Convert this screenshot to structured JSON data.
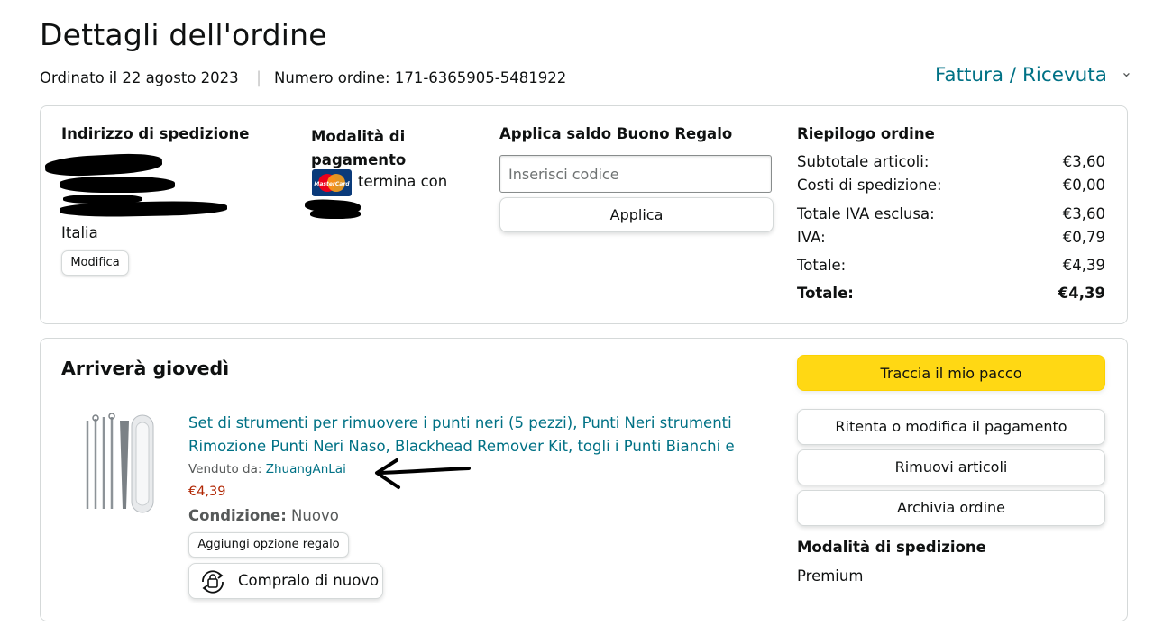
{
  "page": {
    "title": "Dettagli dell'ordine",
    "ordered_on": "Ordinato il 22 agosto 2023",
    "order_number": "Numero ordine: 171-6365905-5481922",
    "invoice_link": "Fattura / Ricevuta",
    "invoice_chevron": "⌄"
  },
  "shipping_address": {
    "heading": "Indirizzo di spedizione",
    "country": "Italia",
    "edit_label": "Modifica"
  },
  "payment": {
    "heading": "Modalità di pagamento",
    "card_brand": "MasterCard",
    "ending_text": "termina con"
  },
  "gift_card": {
    "heading": "Applica saldo Buono Regalo",
    "placeholder": "Inserisci codice",
    "value": "",
    "apply_label": "Applica"
  },
  "summary": {
    "heading": "Riepilogo ordine",
    "rows": [
      {
        "label": "Subtotale articoli:",
        "value": "€3,60"
      },
      {
        "label": "Costi di spedizione:",
        "value": "€0,00"
      },
      {
        "label": "Totale IVA esclusa:",
        "value": "€3,60"
      },
      {
        "label": "IVA:",
        "value": "€0,79"
      },
      {
        "label": "Totale:",
        "value": "€4,39"
      },
      {
        "label": "Totale:",
        "value": "€4,39"
      }
    ]
  },
  "shipment": {
    "arrival": "Arriverà giovedì",
    "product_title_line1": "Set di strumenti per rimuovere i punti neri (5 pezzi), Punti Neri strumenti",
    "product_title_line2": "Rimozione Punti Neri Naso, Blackhead Remover Kit, togli i Punti Bianchi e",
    "sold_by_label": "Venduto da:",
    "seller": "ZhuangAnLai",
    "price": "€4,39",
    "condition_label": "Condizione:",
    "condition_value": "Nuovo",
    "gift_option_label": "Aggiungi opzione regalo",
    "buy_again_label": "Compralo di nuovo"
  },
  "actions": {
    "track": "Traccia il mio pacco",
    "retry_payment": "Ritenta o modifica il pagamento",
    "remove_items": "Rimuovi articoli",
    "archive": "Archivia ordine"
  },
  "delivery_method": {
    "heading": "Modalità di spedizione",
    "value": "Premium"
  },
  "colors": {
    "link": "#007185",
    "price": "#b12704",
    "track_button": "#ffd814",
    "border": "#d5d9d9"
  }
}
